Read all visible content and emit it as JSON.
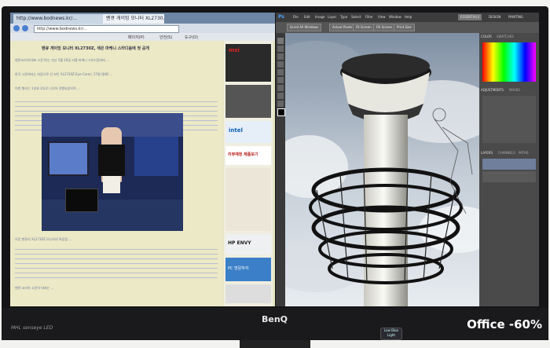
{
  "overlay_label": "Office -60%",
  "monitor": {
    "brand": "BenQ",
    "features": "MHL  senseye  LED",
    "low_blue": "Low Blue Light"
  },
  "browser": {
    "tabs": [
      "http://www.bodnews.kr/...",
      "벤큐 게이밍 모니터 XL2730..."
    ],
    "address": "http://www.bodnews.kr/...",
    "favorites": [
      "페이지(P)",
      "안전(S)",
      "도구(O)"
    ],
    "article_title": "벤큐 게이밍 모니터 XL2730Z, 색은 마케니 스타디움에 첫 공개",
    "paragraphs": [
      "벤큐코리아(대표 소윤석)는 지난 5월 16일 서울 마케니 스타디움에서 ...",
      "한국 시장에서는 처음으로 선 보인 XL2730Z Eye-Care는 27형 QHD ...",
      "이번 행사는 1부와 2부로 나뉘어 진행되었으며 ...",
      "오전 벤큐의 XL2730Z 모니터의 특장점 ...",
      "벤큐 코리아 소윤석 대표는 ..."
    ],
    "ads": [
      "msi",
      "intel",
      "리뷰예정 제품보기",
      "HP ENVY",
      "PC 방문하자"
    ]
  },
  "photoshop": {
    "menu": [
      "Ps",
      "File",
      "Edit",
      "Image",
      "Layer",
      "Type",
      "Select",
      "Filter",
      "View",
      "Window",
      "Help"
    ],
    "workspace": [
      "ESSENTIALS",
      "DESIGN",
      "PAINTING"
    ],
    "options": [
      "Scroll All Windows",
      "Actual Pixels",
      "Fit Screen",
      "Fill Screen",
      "Print Size"
    ],
    "panels": [
      "COLOR",
      "SWATCHES",
      "ADJUSTMENTS",
      "MASKS",
      "LAYERS",
      "CHANNELS",
      "PATHS"
    ]
  }
}
